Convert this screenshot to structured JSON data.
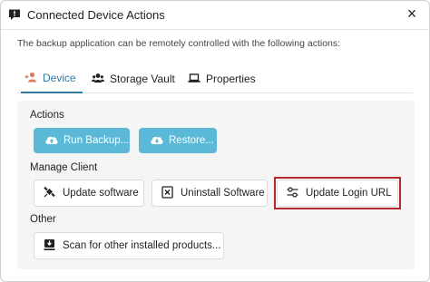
{
  "dialog": {
    "title": "Connected Device Actions",
    "close_symbol": "×",
    "description": "The backup application can be remotely controlled with the following actions:"
  },
  "tabs": [
    {
      "label": "Device",
      "icon": "user-plus-icon",
      "active": true
    },
    {
      "label": "Storage Vault",
      "icon": "users-icon",
      "active": false
    },
    {
      "label": "Properties",
      "icon": "laptop-icon",
      "active": false
    }
  ],
  "sections": {
    "actions": {
      "label": "Actions",
      "buttons": [
        {
          "label": "Run Backup...",
          "icon": "cloud-upload-icon"
        },
        {
          "label": "Restore...",
          "icon": "cloud-download-icon"
        }
      ]
    },
    "manage_client": {
      "label": "Manage Client",
      "buttons": [
        {
          "label": "Update software",
          "icon": "satellite-icon"
        },
        {
          "label": "Uninstall Software",
          "icon": "uninstall-icon"
        },
        {
          "label": "Update Login URL",
          "icon": "sliders-icon",
          "highlighted": true
        }
      ]
    },
    "other": {
      "label": "Other",
      "buttons": [
        {
          "label": "Scan for other installed products...",
          "icon": "scan-download-icon"
        }
      ]
    }
  },
  "colors": {
    "accent": "#2e7aa0",
    "primary_button": "#5bb8d6",
    "highlight": "#b22a2a",
    "panel_bg": "#f5f5f5"
  }
}
